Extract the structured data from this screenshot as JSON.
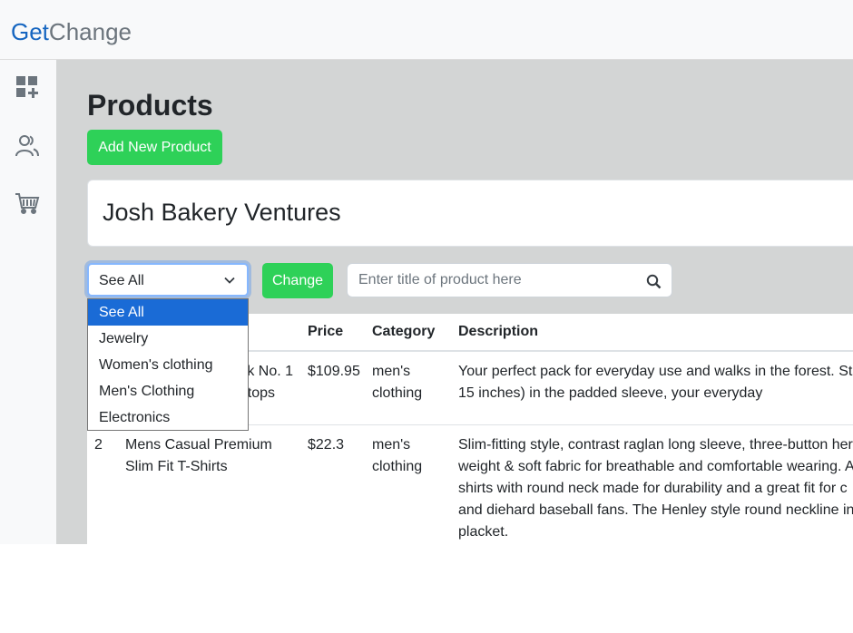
{
  "brand": {
    "part1": "Get",
    "part2": "Change",
    "color1": "#1565c0",
    "color2": "#6c757d"
  },
  "sidebar": {
    "items": [
      {
        "icon": "dashboard-add-icon",
        "name": "dashboard"
      },
      {
        "icon": "users-icon",
        "name": "users"
      },
      {
        "icon": "cart-icon",
        "name": "cart"
      }
    ]
  },
  "page": {
    "title": "Products",
    "add_button": "Add New Product"
  },
  "store": {
    "name": "Josh Bakery Ventures"
  },
  "filter": {
    "selected": "See All",
    "options": [
      "See All",
      "Jewelry",
      "Women's clothing",
      "Men's Clothing",
      "Electronics"
    ],
    "change_button": "Change",
    "search_placeholder": "Enter title of product here"
  },
  "table": {
    "headers": [
      "",
      "",
      "Price",
      "Category",
      "Description"
    ],
    "rows": [
      {
        "id": "",
        "title_lines": [
          "k No. 1",
          "ptops"
        ],
        "price": "$109.95",
        "category_lines": [
          "men's",
          "clothing"
        ],
        "description_lines": [
          "Your perfect pack for everyday use and walks in the forest. Sta",
          "15 inches) in the padded sleeve, your everyday"
        ]
      },
      {
        "id": "2",
        "title_lines": [
          "Mens Casual Premium",
          "Slim Fit T-Shirts"
        ],
        "price": "$22.3",
        "category_lines": [
          "men's",
          "clothing"
        ],
        "description_lines": [
          "Slim-fitting style, contrast raglan long sleeve, three-button her",
          "weight & soft fabric for breathable and comfortable wearing. A",
          "shirts with round neck made for durability and a great fit for c",
          "and diehard baseball fans. The Henley style round neckline inc",
          "placket."
        ]
      }
    ]
  },
  "colors": {
    "accent_green": "#2ed158",
    "selected_blue": "#1a6bd6",
    "main_bg": "#d3d5d5"
  }
}
